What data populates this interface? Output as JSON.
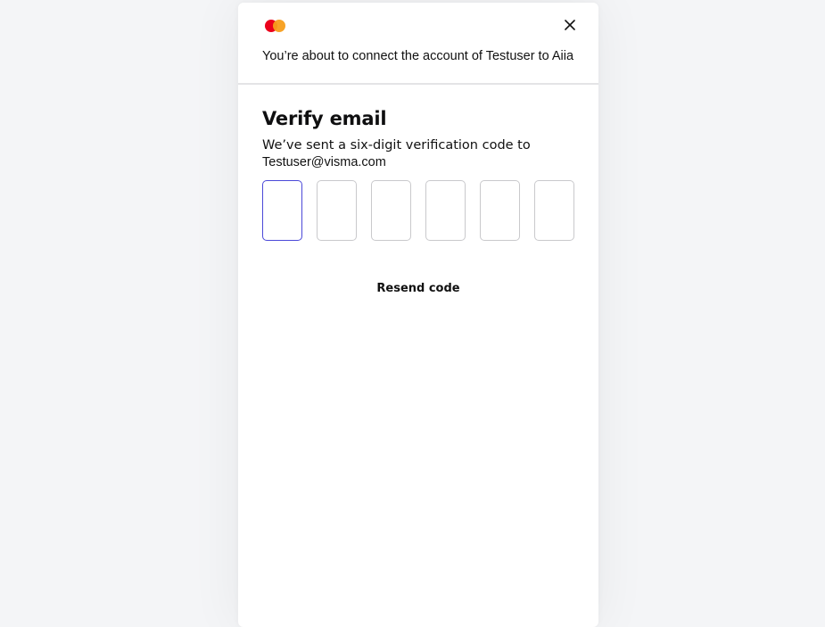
{
  "header": {
    "logo_icon": "mastercard-logo-icon",
    "logo_colors": {
      "left": "#eb001b",
      "right": "#f79e1b"
    },
    "close_icon": "close-icon",
    "connect_text": "You’re about to connect the account of Testuser to Aiia"
  },
  "verify": {
    "title": "Verify email",
    "subtitle": "We’ve sent a six-digit verification code to",
    "email": "Testuser@visma.com",
    "code_digits": [
      "",
      "",
      "",
      "",
      "",
      ""
    ],
    "active_border_color": "#4b49d8",
    "resend_label": "Resend code"
  }
}
